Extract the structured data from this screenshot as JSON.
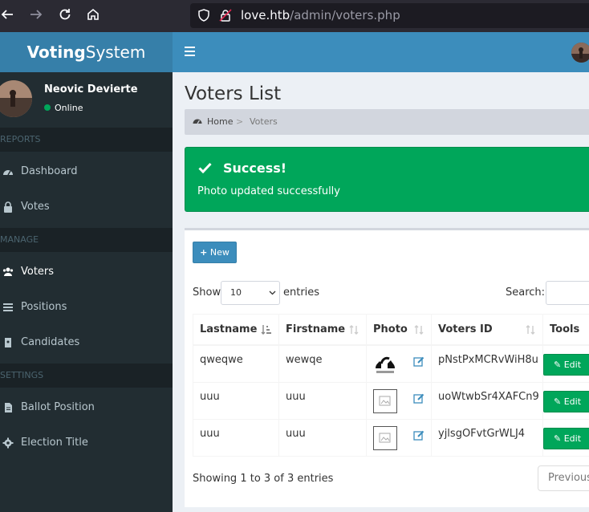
{
  "browser": {
    "url_host": "love.htb",
    "url_path": "/admin/voters.php",
    "icons": [
      "back-icon",
      "forward-icon",
      "reload-icon",
      "home-icon",
      "shield-icon",
      "lock-icon"
    ]
  },
  "header": {
    "logo_bold": "Voting",
    "logo_light": "System"
  },
  "sidebar": {
    "user_name": "Neovic Devierte",
    "user_status": "Online",
    "sections": {
      "reports": "REPORTS",
      "manage": "MANAGE",
      "settings": "SETTINGS"
    },
    "items": [
      {
        "label": "Dashboard",
        "icon": "dashboard-icon"
      },
      {
        "label": "Votes",
        "icon": "lock-icon"
      },
      {
        "label": "Voters",
        "icon": "users-icon"
      },
      {
        "label": "Positions",
        "icon": "list-icon"
      },
      {
        "label": "Candidates",
        "icon": "id-card-icon"
      },
      {
        "label": "Ballot Position",
        "icon": "file-icon"
      },
      {
        "label": "Election Title",
        "icon": "gear-icon"
      }
    ]
  },
  "page": {
    "title": "Voters List",
    "breadcrumb_home": "Home",
    "breadcrumb_sep": ">",
    "breadcrumb_current": "Voters"
  },
  "alert": {
    "title": "Success!",
    "message": "Photo updated successfully"
  },
  "table_controls": {
    "new_button": "New",
    "show_label": "Show",
    "page_size": "10",
    "entries_label": "entries",
    "search_label": "Search:",
    "search_value": ""
  },
  "table": {
    "columns": [
      "Lastname",
      "Firstname",
      "Photo",
      "Voters ID",
      "Tools"
    ],
    "rows": [
      {
        "lastname": "qweqwe",
        "firstname": "wewqe",
        "photo": "friendzone-image",
        "voters_id": "pNstPxMCRvWiH8u",
        "edit": "Edit"
      },
      {
        "lastname": "uuu",
        "firstname": "uuu",
        "photo": "broken-image",
        "voters_id": "uoWtwbSr4XAFCn9",
        "edit": "Edit"
      },
      {
        "lastname": "uuu",
        "firstname": "uuu",
        "photo": "broken-image",
        "voters_id": "yjlsgOFvtGrWLJ4",
        "edit": "Edit"
      }
    ]
  },
  "footer": {
    "info": "Showing 1 to 3 of 3 entries",
    "previous": "Previous"
  },
  "colors": {
    "header_blue": "#3c8dbc",
    "logo_blue": "#367fa9",
    "sidebar": "#222d32",
    "success": "#00a65a"
  }
}
